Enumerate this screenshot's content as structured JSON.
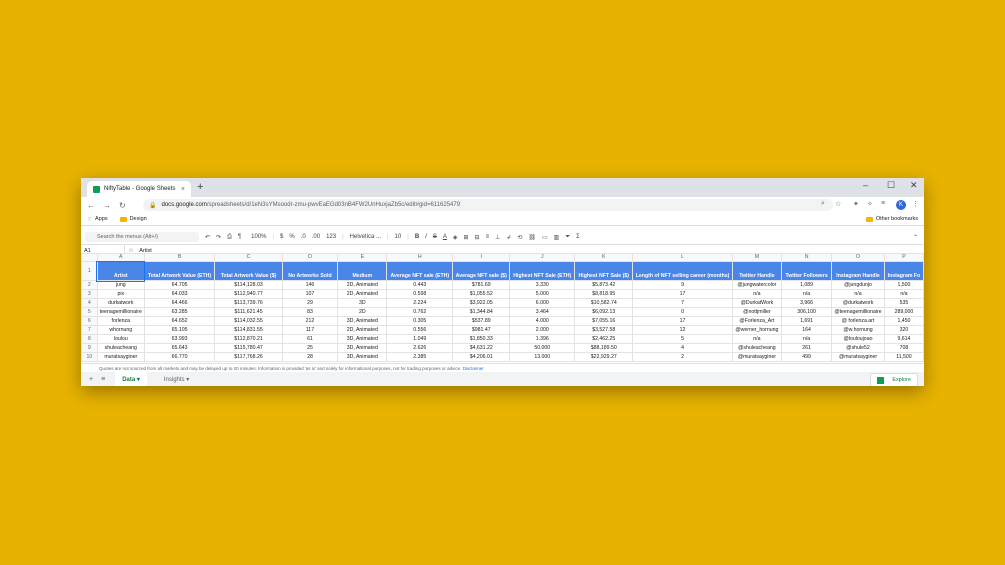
{
  "browser": {
    "tab_title": "NiftyTable - Google Sheets",
    "tab_close": "×",
    "new_tab": "+",
    "url_host": "docs.google.com",
    "url_path": "/spreadsheets/d/1eN3sYMsoodr-zmu-pwvEaEGd03nB4FW2UnHuxjaZb5c/edit#gid=611625479",
    "avatar_letter": "K",
    "window_controls": [
      "–",
      "☐",
      "✕"
    ]
  },
  "bookmarks": {
    "apps": "Apps",
    "design": "Design",
    "other": "Other bookmarks"
  },
  "toolbar": {
    "search_placeholder": "Search the menus (Alt+/)",
    "zoom": "100%",
    "currency": "$",
    "percent": "%",
    "decimals_less": ".0",
    "decimals_more": ".00",
    "number_format": "123",
    "font": "Helvetica ...",
    "font_size": "10",
    "bold": "B",
    "italic": "I",
    "strike": "S",
    "text_color": "A"
  },
  "formula_bar": {
    "cell_ref": "A1",
    "fx": "fx",
    "value": "Artist"
  },
  "sheet": {
    "columns": [
      "A",
      "B",
      "C",
      "D",
      "E",
      "H",
      "I",
      "J",
      "K",
      "L",
      "M",
      "N",
      "O",
      "P"
    ],
    "header_row": [
      "Artist",
      "Total Artwork Value (ETH)",
      "Total Artwork Value ($)",
      "No Artworks Sold",
      "Medium",
      "Average NFT sale (ETH)",
      "Average NFT sale ($)",
      "Highest NFT Sale (ETH)",
      "Highest NFT Sale ($)",
      "Length of NFT selling career (months)",
      "Twitter Handle",
      "Twitter Followers",
      "Instagram Handle",
      "Instagram Fo"
    ],
    "rows": [
      [
        "jung",
        "64.705",
        "$114,128.03",
        "146",
        "2D, Animated",
        "0.443",
        "$781.69",
        "3.330",
        "$5,873.42",
        "9",
        "@jungwatercolor",
        "1,089",
        "@jungdunjo",
        "1,500"
      ],
      [
        "pix",
        "64.033",
        "$112,940.77",
        "107",
        "2D, Animated",
        "0.598",
        "$1,055.52",
        "5.000",
        "$8,818.95",
        "17",
        "n/a",
        "n/a",
        "n/a",
        "n/a"
      ],
      [
        "durkatwork",
        "64.466",
        "$113,739.76",
        "29",
        "3D",
        "2.224",
        "$3,922.05",
        "6.000",
        "$10,582.74",
        "7",
        "@DurkatWork",
        "3,966",
        "@durkatwork",
        "535"
      ],
      [
        "teenagemillionaire",
        "63.285",
        "$111,621.45",
        "83",
        "2D",
        "0.762",
        "$1,344.84",
        "3.464",
        "$6,092.13",
        "0",
        "@nottjmiller",
        "306,100",
        "@teenagemillionaire",
        "289,000"
      ],
      [
        "forlenza",
        "64.652",
        "$114,032.55",
        "212",
        "3D, Animated",
        "0.305",
        "$537.89",
        "4.000",
        "$7,055.16",
        "17",
        "@Forlenza_Art",
        "1,691",
        "@ forlenza.art",
        "1,450"
      ],
      [
        "whornung",
        "65.105",
        "$114,831.55",
        "117",
        "2D, Animated",
        "0.556",
        "$981.47",
        "2.000",
        "$3,527.58",
        "12",
        "@werner_hornung",
        "164",
        "@w.hornung",
        "320"
      ],
      [
        "loulou",
        "63.993",
        "$112,870.21",
        "61",
        "3D, Animated",
        "1.049",
        "$1,850.33",
        "1.396",
        "$2,462.25",
        "5",
        "n/a",
        "n/a",
        "@louloujoao",
        "9,614"
      ],
      [
        "shuleacheang",
        "65.643",
        "$115,780.47",
        "25",
        "3D, Animated",
        "2.626",
        "$4,631.22",
        "50.000",
        "$88,189.50",
        "4",
        "@shuleacheang",
        "261",
        "@shule52",
        "708"
      ],
      [
        "muratsayginer",
        "66.770",
        "$117,768.26",
        "28",
        "3D, Animated",
        "2.385",
        "$4,206.01",
        "13.000",
        "$22,929.27",
        "2",
        "@muratsayginer",
        "499",
        "@muratsayginer",
        "11,500"
      ]
    ]
  },
  "footnote": {
    "text": "Quotes are not sourced from all markets and may be delayed up to 20 minutes. Information is provided 'as is' and solely for informational purposes, not for trading purposes or advice.",
    "link": "Disclaimer"
  },
  "sheet_tabs": {
    "add": "+",
    "all_sheets": "≡",
    "tabs": [
      "Data ▾",
      "Insights ▾"
    ],
    "explore": "Explore"
  }
}
